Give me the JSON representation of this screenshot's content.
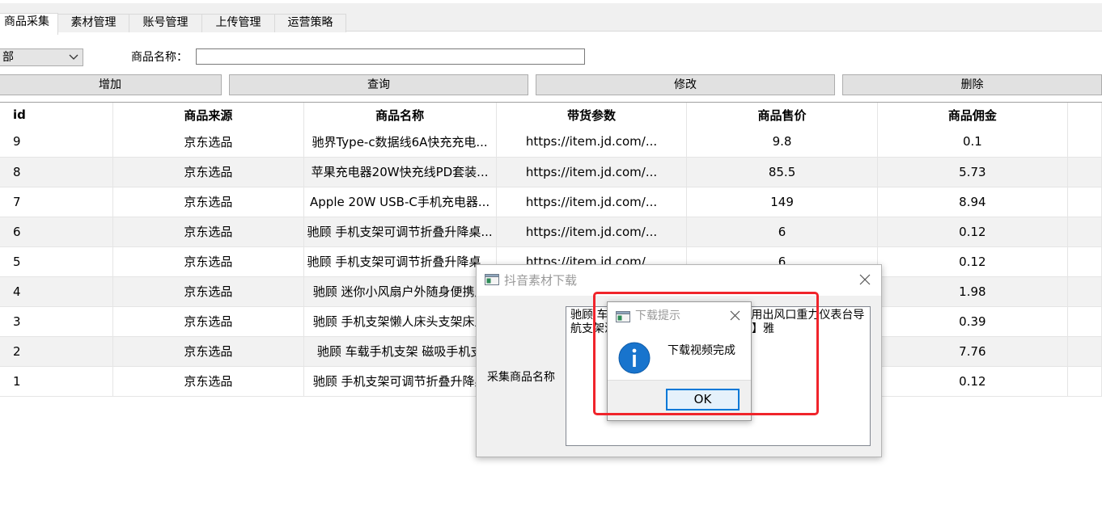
{
  "tabs": [
    {
      "label": "商品采集",
      "active": true
    },
    {
      "label": "素材管理",
      "active": false
    },
    {
      "label": "账号管理",
      "active": false
    },
    {
      "label": "上传管理",
      "active": false
    },
    {
      "label": "运营策略",
      "active": false
    }
  ],
  "filter": {
    "category_value": "部",
    "name_label": "商品名称：",
    "name_value": ""
  },
  "buttons": {
    "add": "增加",
    "query": "查询",
    "edit": "修改",
    "delete": "删除"
  },
  "table": {
    "columns": [
      "id",
      "商品来源",
      "商品名称",
      "带货参数",
      "商品售价",
      "商品佣金"
    ],
    "rows": [
      [
        "9",
        "京东选品",
        "驰界Type-c数据线6A快充充电...",
        "https://item.jd.com/...",
        "9.8",
        "0.1"
      ],
      [
        "8",
        "京东选品",
        "苹果充电器20W快充线PD套装...",
        "https://item.jd.com/...",
        "85.5",
        "5.73"
      ],
      [
        "7",
        "京东选品",
        "Apple 20W USB-C手机充电器...",
        "https://item.jd.com/...",
        "149",
        "8.94"
      ],
      [
        "6",
        "京东选品",
        "驰顾 手机支架可调节折叠升降桌...",
        "https://item.jd.com/...",
        "6",
        "0.12"
      ],
      [
        "5",
        "京东选品",
        "驰顾 手机支架可调节折叠升降桌...",
        "https://item.jd.com/...",
        "6",
        "0.12"
      ],
      [
        "4",
        "京东选品",
        "驰顾 迷你小风扇户外随身便携风",
        "",
        "",
        "1.98"
      ],
      [
        "3",
        "京东选品",
        "驰顾 手机支架懒人床头支架床上",
        "",
        "",
        "0.39"
      ],
      [
        "2",
        "京东选品",
        "驰顾 车载手机支架 磁吸手机支",
        "",
        "",
        "7.76"
      ],
      [
        "1",
        "京东选品",
        "驰顾 手机支架可调节折叠升降桌",
        "",
        "",
        "0.12"
      ]
    ]
  },
  "download_window": {
    "title": "抖音素材下载",
    "collect_label": "采集商品名称",
    "collect_text": "驰顾 车载手机支架 磁吸手机支架 车用出风口重力仪表台导航支架汽车用品【仪台表粘帖式磁吸】雅"
  },
  "message_box": {
    "title": "下载提示",
    "text": "下载视频完成",
    "ok_label": "OK"
  },
  "colors": {
    "highlight": "#f0242b",
    "info_icon": "#1874cd",
    "ok_border": "#0078d7"
  }
}
